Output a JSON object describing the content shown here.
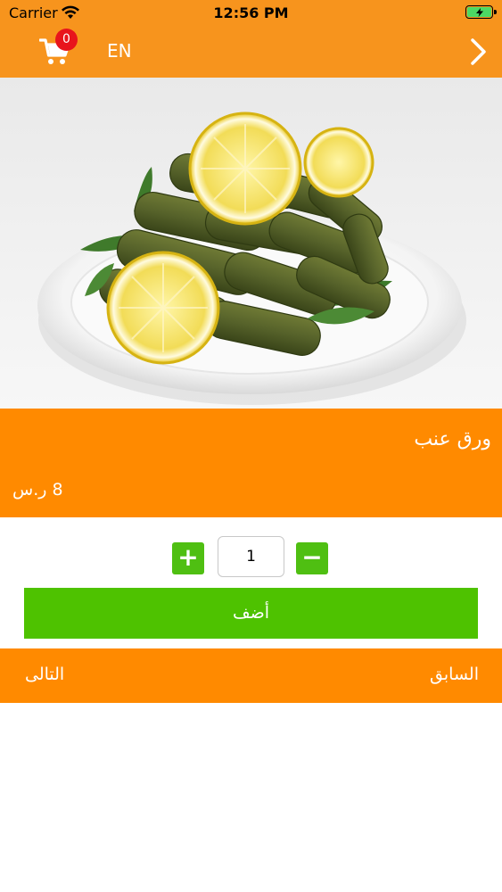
{
  "status_bar": {
    "carrier": "Carrier",
    "time": "12:56 PM"
  },
  "nav": {
    "cart_count": "0",
    "language": "EN",
    "back_icon": "chevron-right-icon",
    "cart_icon": "cart-icon"
  },
  "product": {
    "name": "ورق عنب",
    "price": "8 ر.س",
    "quantity": "1"
  },
  "actions": {
    "plus_label": "+",
    "minus_label": "−",
    "add_label": "أضف",
    "previous_label": "السابق",
    "next_label": "التالى"
  },
  "colors": {
    "header": "#f7941d",
    "accent": "#ff8a00",
    "action_green": "#4ec200",
    "badge_red": "#e8141c"
  }
}
